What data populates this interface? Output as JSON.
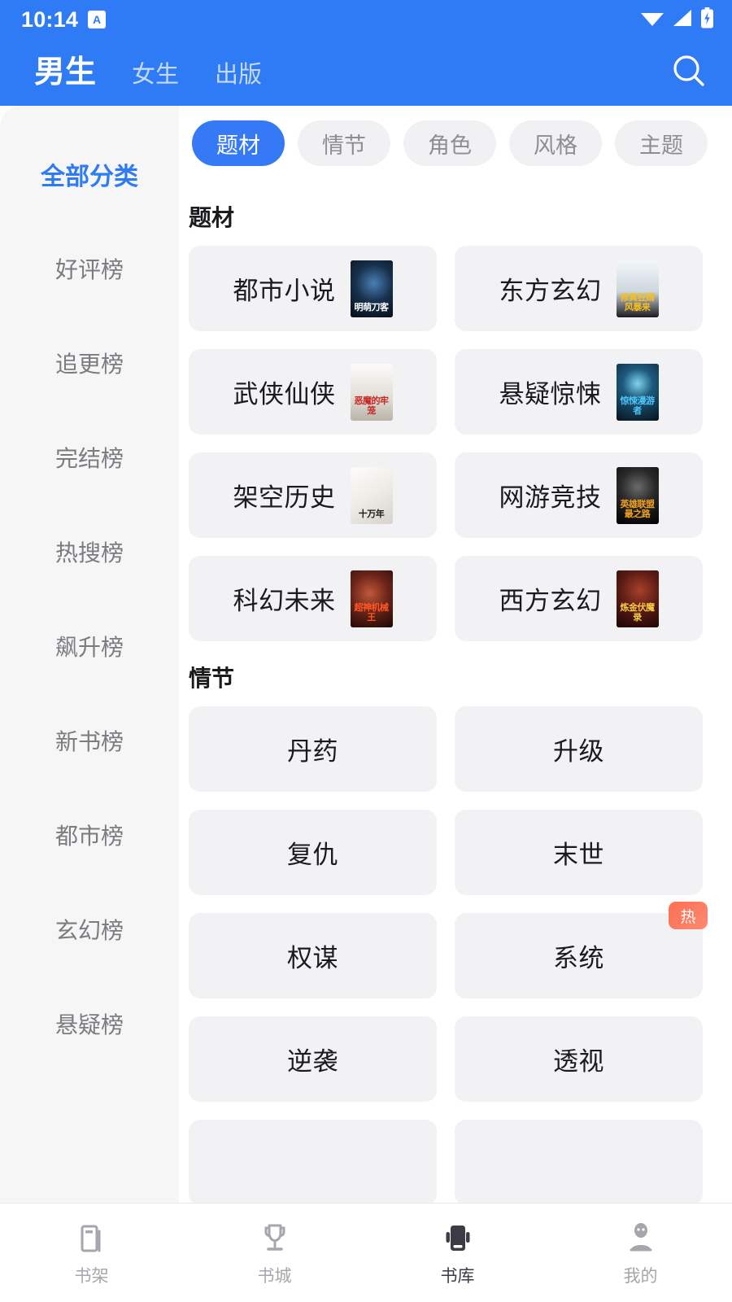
{
  "statusbar": {
    "time": "10:14",
    "app_badge": "A",
    "icons": [
      "wifi-icon",
      "signal-icon",
      "battery-charging-icon"
    ]
  },
  "header": {
    "tabs": [
      {
        "label": "男生",
        "active": true
      },
      {
        "label": "女生",
        "active": false
      },
      {
        "label": "出版",
        "active": false
      }
    ],
    "search_icon": "search-icon"
  },
  "sidebar": {
    "items": [
      {
        "label": "全部分类",
        "active": true
      },
      {
        "label": "好评榜",
        "active": false
      },
      {
        "label": "追更榜",
        "active": false
      },
      {
        "label": "完结榜",
        "active": false
      },
      {
        "label": "热搜榜",
        "active": false
      },
      {
        "label": "飙升榜",
        "active": false
      },
      {
        "label": "新书榜",
        "active": false
      },
      {
        "label": "都市榜",
        "active": false
      },
      {
        "label": "玄幻榜",
        "active": false
      },
      {
        "label": "悬疑榜",
        "active": false
      }
    ]
  },
  "filters": {
    "chips": [
      {
        "label": "题材",
        "active": true
      },
      {
        "label": "情节",
        "active": false
      },
      {
        "label": "角色",
        "active": false
      },
      {
        "label": "风格",
        "active": false
      },
      {
        "label": "主题",
        "active": false
      }
    ]
  },
  "sections": [
    {
      "title": "题材",
      "has_covers": true,
      "items": [
        {
          "label": "都市小说",
          "cover_title": "明萌刀客",
          "cover_bg": "#0b1624",
          "cover_accent": "#5b8dc4",
          "cover_text": "#ffffff"
        },
        {
          "label": "东方玄幻",
          "cover_title": "修真狂婿风暴来",
          "cover_bg": "#e8ecef",
          "cover_accent": "#b7c3cc",
          "cover_text": "#f4c020"
        },
        {
          "label": "武侠仙侠",
          "cover_title": "恶魔的牢笼",
          "cover_bg": "#f0eeea",
          "cover_accent": "#c9c4bc",
          "cover_text": "#c62828"
        },
        {
          "label": "悬疑惊悚",
          "cover_title": "惊悚漫游者",
          "cover_bg": "#0d2030",
          "cover_accent": "#2b6a8c",
          "cover_text": "#4fc3f7"
        },
        {
          "label": "架空历史",
          "cover_title": "十万年",
          "cover_bg": "#f3f1ee",
          "cover_accent": "#2b2b2b",
          "cover_text": "#1b1b1b"
        },
        {
          "label": "网游竞技",
          "cover_title": "英雄联盟最之路",
          "cover_bg": "#101010",
          "cover_accent": "#3a3a3a",
          "cover_text": "#f0a020"
        },
        {
          "label": "科幻未来",
          "cover_title": "超神机械王",
          "cover_bg": "#3a1410",
          "cover_accent": "#8c3a22",
          "cover_text": "#ff5722"
        },
        {
          "label": "西方玄幻",
          "cover_title": "炼金伏魔录",
          "cover_bg": "#2a0e0c",
          "cover_accent": "#7a2a1c",
          "cover_text": "#f6c945"
        }
      ]
    },
    {
      "title": "情节",
      "has_covers": false,
      "items": [
        {
          "label": "丹药"
        },
        {
          "label": "升级"
        },
        {
          "label": "复仇"
        },
        {
          "label": "末世"
        },
        {
          "label": "权谋"
        },
        {
          "label": "系统",
          "badge": "热"
        },
        {
          "label": "逆袭"
        },
        {
          "label": "透视"
        },
        {
          "label": "",
          "partial": true
        },
        {
          "label": "",
          "partial": true
        }
      ]
    }
  ],
  "bottomnav": {
    "items": [
      {
        "label": "书架",
        "icon": "bookshelf-icon",
        "active": false
      },
      {
        "label": "书城",
        "icon": "trophy-icon",
        "active": false
      },
      {
        "label": "书库",
        "icon": "library-icon",
        "active": true
      },
      {
        "label": "我的",
        "icon": "person-icon",
        "active": false
      }
    ]
  },
  "colors": {
    "brand": "#2f7bf6",
    "chip_active": "#3579f6",
    "sidebar_bg": "#f6f6f7",
    "cell_bg": "#f2f2f4",
    "badge": "#fd6f52"
  }
}
